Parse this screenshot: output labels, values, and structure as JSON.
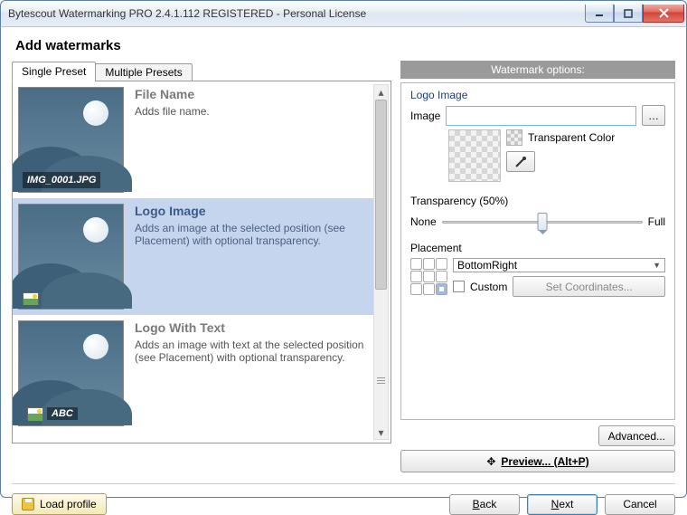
{
  "window": {
    "title": "Bytescout Watermarking PRO 2.4.1.112 REGISTERED - Personal License"
  },
  "heading": "Add watermarks",
  "tabs": {
    "single": "Single Preset",
    "multiple": "Multiple Presets"
  },
  "presets": [
    {
      "title": "File Name",
      "desc": "Adds file name.",
      "overlay_text": "IMG_0001.JPG"
    },
    {
      "title": "Logo Image",
      "desc": "Adds an image at the selected position (see Placement) with optional transparency."
    },
    {
      "title": "Logo With Text",
      "desc": "Adds an image with text at the selected position (see Placement) with optional transparency.",
      "overlay_text": "ABC"
    }
  ],
  "options": {
    "header": "Watermark options:",
    "logo_group": "Logo Image",
    "image_label": "Image",
    "transparent_color": "Transparent Color",
    "transparency_label": "Transparency (50%)",
    "transparency_none": "None",
    "transparency_full": "Full",
    "placement_label": "Placement",
    "placement_value": "BottomRight",
    "custom_label": "Custom",
    "set_coords": "Set Coordinates...",
    "advanced": "Advanced...",
    "preview": "Preview... (Alt+P)"
  },
  "footer": {
    "load_profile": "Load profile",
    "back": "Back",
    "next": "Next",
    "cancel": "Cancel"
  }
}
